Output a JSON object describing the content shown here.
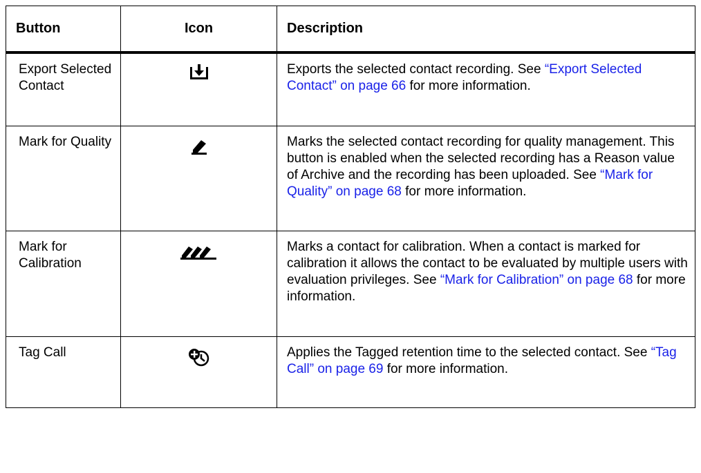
{
  "table": {
    "headers": {
      "button": "Button",
      "icon": "Icon",
      "description": "Description"
    },
    "rows": [
      {
        "button": "Export Selected Contact",
        "icon": "export-download-icon",
        "desc_before": "Exports the selected contact recording. See ",
        "desc_link": "“Export Selected Contact” on page 66",
        "desc_after": " for more information."
      },
      {
        "button": "Mark for Quality",
        "icon": "pen-mark-icon",
        "desc_before": "Marks the selected contact recording for quality management. This button is enabled when the selected recording has a Reason value of Archive and the recording has been uploaded. See ",
        "desc_link": "“Mark for Quality” on page 68",
        "desc_after": " for more information."
      },
      {
        "button": "Mark for Calibration",
        "icon": "multi-pen-calibration-icon",
        "desc_before": "Marks a contact for calibration. When a contact is marked for calibration it allows the contact to be evaluated by multiple users with evaluation privileges. See ",
        "desc_link": "“Mark for Calibration” on page 68",
        "desc_after": " for more information."
      },
      {
        "button": "Tag Call",
        "icon": "tag-clock-icon",
        "desc_before": "Applies the Tagged retention time to the selected contact. See ",
        "desc_link": "“Tag Call” on page 69",
        "desc_after": " for more information."
      }
    ]
  },
  "colors": {
    "link": "#1a22e8",
    "border": "#000000",
    "text": "#000000"
  }
}
